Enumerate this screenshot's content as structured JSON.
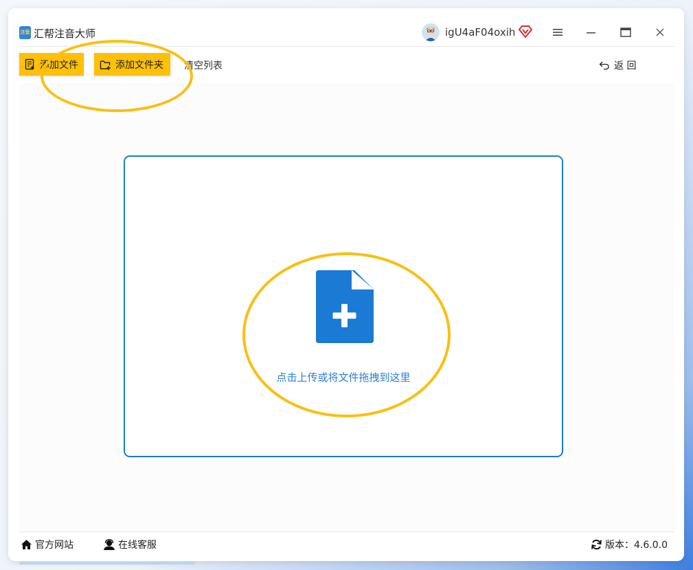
{
  "app": {
    "title": "汇帮注音大师",
    "logo_text": "注音"
  },
  "user": {
    "name": "igU4aF04oxih"
  },
  "window_controls": {
    "menu_icon": "hamburger-icon",
    "minimize_icon": "minimize-icon",
    "maximize_icon": "maximize-icon",
    "close_icon": "close-icon"
  },
  "toolbar": {
    "add_file_label": "添加文件",
    "add_folder_label": "添加文件夹",
    "clear_list_label": "清空列表",
    "back_label": "返 回"
  },
  "dropzone": {
    "text": "点击上传或将文件拖拽到这里"
  },
  "footer": {
    "website_label": "官方网站",
    "support_label": "在线客服",
    "version_label": "版本：4.6.0.0"
  },
  "colors": {
    "accent_yellow": "#ffc107",
    "annotation": "#fbbf10",
    "primary_blue": "#1a7ad4",
    "vip_red": "#e02a2a"
  }
}
